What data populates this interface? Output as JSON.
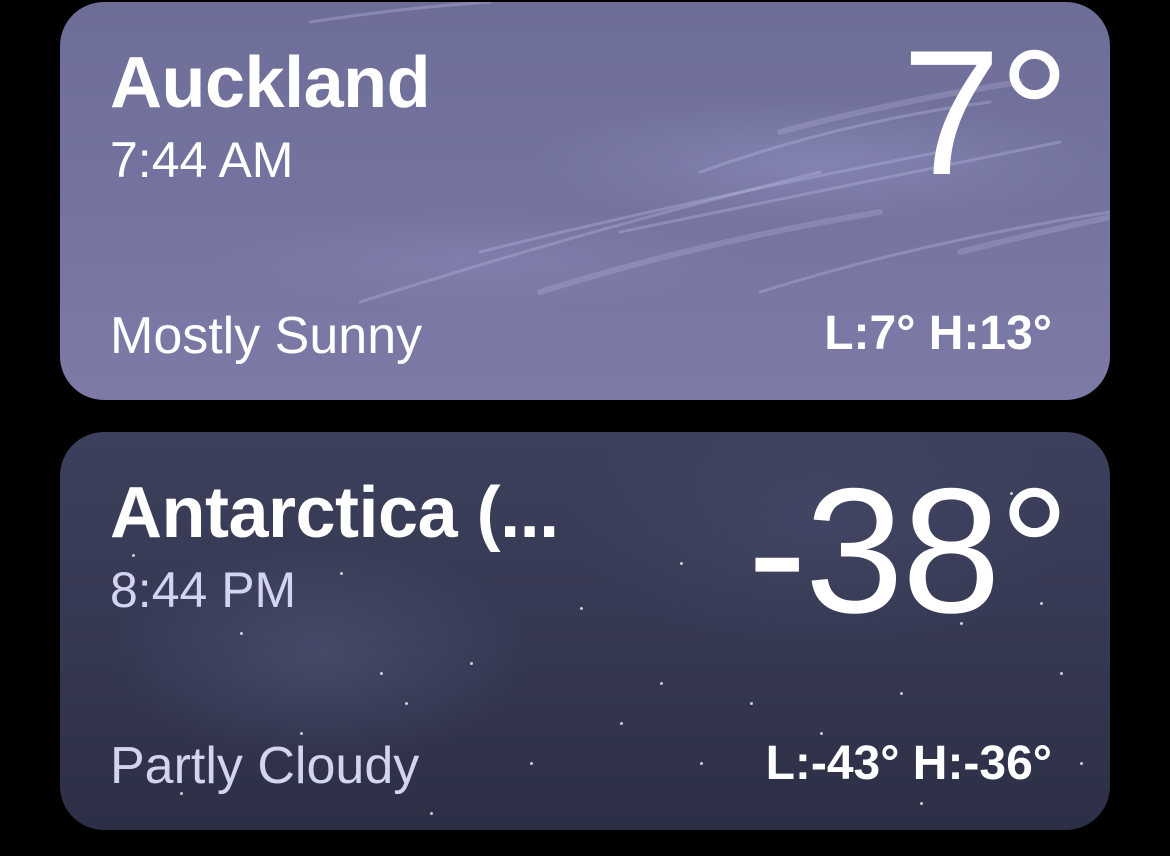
{
  "locations": [
    {
      "city": "Auckland",
      "time": "7:44 AM",
      "temperature": "7°",
      "condition": "Mostly Sunny",
      "low_high": "L:7° H:13°",
      "theme": "day-cloudy",
      "background_color": "#74739f"
    },
    {
      "city": "Antarctica (...",
      "time": "8:44 PM",
      "temperature": "-38°",
      "condition": "Partly Cloudy",
      "low_high": "L:-43° H:-36°",
      "theme": "night-stars",
      "background_color": "#353851"
    }
  ],
  "colors": {
    "page_background": "#000000",
    "text_primary": "#ffffff",
    "text_secondary_night": "#d3d4f1"
  }
}
